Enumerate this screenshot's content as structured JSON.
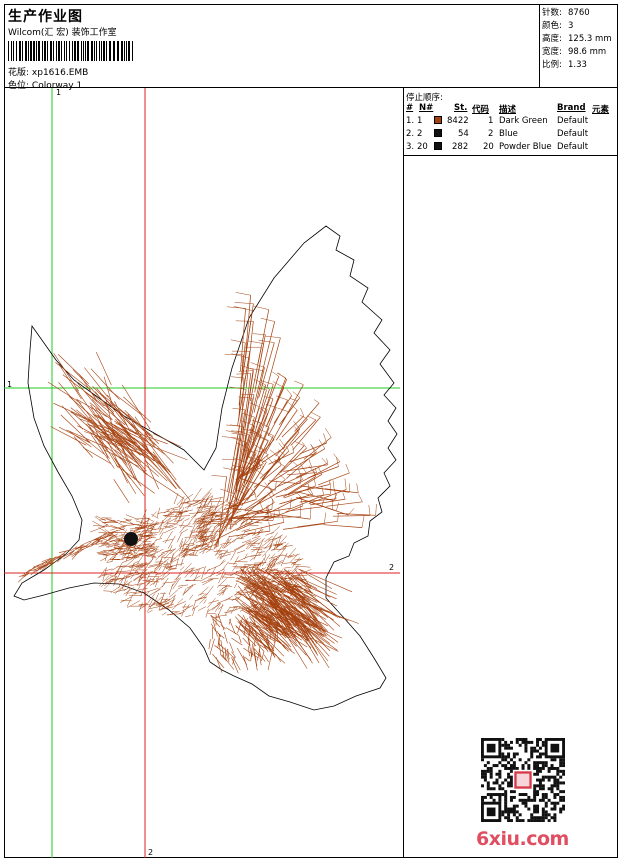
{
  "header": {
    "title": "生产作业图",
    "company": "Wilcom(汇 宏) 装饰工作室",
    "design_label": "花版:",
    "design_value": "xp1616.EMB",
    "colorway_label": "色位:",
    "colorway_value": "Colorway 1"
  },
  "stats": [
    {
      "label": "针数:",
      "value": "8760"
    },
    {
      "label": "颜色:",
      "value": "3"
    },
    {
      "label": "高度:",
      "value": "125.3 mm"
    },
    {
      "label": "宽度:",
      "value": "98.6 mm"
    },
    {
      "label": "比例:",
      "value": "1.33"
    }
  ],
  "stop_sequence": {
    "title": "停止顺序:",
    "columns": [
      "#",
      "N#",
      "St.",
      "代码",
      "描述",
      "Brand",
      "元素"
    ],
    "rows": [
      {
        "num": "1.",
        "n": "1",
        "color": "#a5410f",
        "st": "8422",
        "code": "1",
        "desc": "Dark Green",
        "brand": "Default"
      },
      {
        "num": "2.",
        "n": "2",
        "color": "#111111",
        "st": "54",
        "code": "2",
        "desc": "Blue",
        "brand": "Default"
      },
      {
        "num": "3.",
        "n": "20",
        "color": "#111111",
        "st": "282",
        "code": "20",
        "desc": "Powder Blue",
        "brand": "Default"
      }
    ]
  },
  "axes": {
    "v1_top": "1",
    "h1_left": "1",
    "h2_right": "2",
    "v2_bottom": "2"
  },
  "colors": {
    "thread": "#a5410f",
    "guide_green": "#22cc22",
    "guide_red": "#dd2222",
    "watermark": "#e04e62"
  },
  "watermark": "6xiu.com"
}
